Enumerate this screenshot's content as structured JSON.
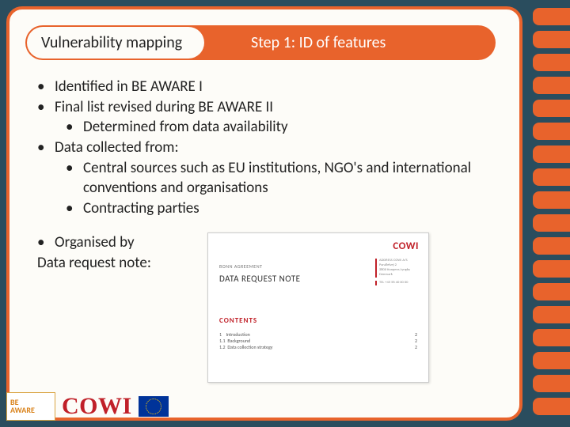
{
  "header": {
    "title": "Vulnerability mapping",
    "subtitle": "Step 1: ID of features"
  },
  "bullets": {
    "b1": "Identified in BE AWARE I",
    "b2": "Final list revised during BE AWARE II",
    "b2a": "Determined from data availability",
    "b3": "Data collected from:",
    "b3a": "Central sources such as EU institutions, NGO's and international conventions and organisations",
    "b3b": "Contracting parties",
    "b4a": "Organised by",
    "b4b": "Data request note:"
  },
  "doc": {
    "brand": "COWI",
    "agreement": "BONN AGREEMENT",
    "title": "DATA REQUEST NOTE",
    "contents_label": "CONTENTS",
    "toc": [
      {
        "num": "1",
        "label": "Introduction",
        "page": "2"
      },
      {
        "num": "1.1",
        "label": "Background",
        "page": "2"
      },
      {
        "num": "1.2",
        "label": "Data collection strategy",
        "page": "2"
      }
    ]
  },
  "logos": {
    "beaware_l1": "BE",
    "beaware_l2": "AWARE",
    "cowi": "COWI"
  }
}
